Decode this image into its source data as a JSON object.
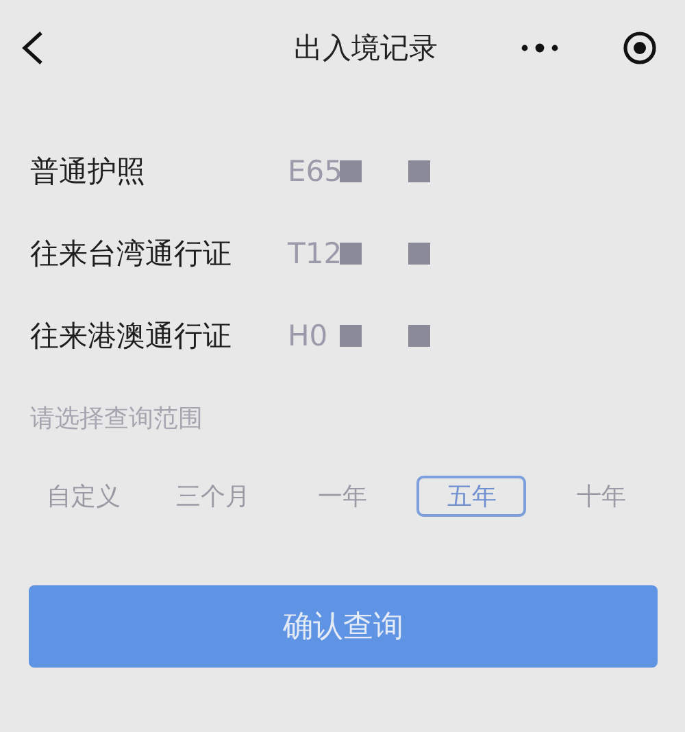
{
  "nav": {
    "title": "出入境记录"
  },
  "documents": [
    {
      "name": "普通护照",
      "number": "E65"
    },
    {
      "name": "往来台湾通行证",
      "number": "T12"
    },
    {
      "name": "往来港澳通行证",
      "number": "H0"
    }
  ],
  "range": {
    "label": "请选择查询范围",
    "options": [
      {
        "label": "自定义",
        "selected": false
      },
      {
        "label": "三个月",
        "selected": false
      },
      {
        "label": "一年",
        "selected": false
      },
      {
        "label": "五年",
        "selected": true
      },
      {
        "label": "十年",
        "selected": false
      }
    ]
  },
  "submit": {
    "label": "确认查询"
  }
}
